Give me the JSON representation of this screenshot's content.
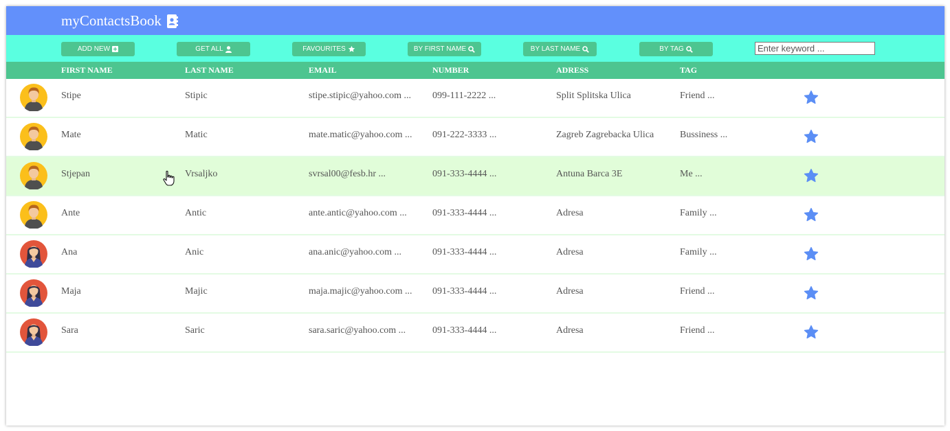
{
  "app": {
    "title": "myContactsBook",
    "title_icon": "address-book-icon"
  },
  "toolbar": {
    "buttons": [
      {
        "label": "ADD NEW",
        "icon": "plus-square-icon"
      },
      {
        "label": "GET ALL",
        "icon": "user-icon"
      },
      {
        "label": "FAVOURITES",
        "icon": "star-icon"
      },
      {
        "label": "BY FIRST NAME",
        "icon": "search-icon"
      },
      {
        "label": "BY LAST NAME",
        "icon": "search-icon"
      },
      {
        "label": "BY TAG",
        "icon": "search-icon"
      }
    ],
    "search": {
      "placeholder": "Enter keyword ...",
      "value": ""
    }
  },
  "table": {
    "headers": [
      "FIRST NAME",
      "LAST NAME",
      "EMAIL",
      "NUMBER",
      "ADRESS",
      "TAG"
    ],
    "rows": [
      {
        "first": "Stipe",
        "last": "Stipic",
        "email": "stipe.stipic@yahoo.com ...",
        "number": "099-111-2222 ...",
        "address": "Split Splitska Ulica",
        "tag": "Friend ...",
        "avatar": "male-avatar-icon"
      },
      {
        "first": "Mate",
        "last": "Matic",
        "email": "mate.matic@yahoo.com ...",
        "number": "091-222-3333 ...",
        "address": "Zagreb Zagrebacka Ulica",
        "tag": "Bussiness ...",
        "avatar": "male-avatar-icon"
      },
      {
        "first": "Stjepan",
        "last": "Vrsaljko",
        "email": "svrsal00@fesb.hr ...",
        "number": "091-333-4444 ...",
        "address": "Antuna Barca 3E",
        "tag": "Me ...",
        "avatar": "male-avatar-icon"
      },
      {
        "first": "Ante",
        "last": "Antic",
        "email": "ante.antic@yahoo.com ...",
        "number": "091-333-4444 ...",
        "address": "Adresa",
        "tag": "Family ...",
        "avatar": "male-avatar-icon"
      },
      {
        "first": "Ana",
        "last": "Anic",
        "email": "ana.anic@yahoo.com ...",
        "number": "091-333-4444 ...",
        "address": "Adresa",
        "tag": "Family ...",
        "avatar": "female-avatar-icon"
      },
      {
        "first": "Maja",
        "last": "Majic",
        "email": "maja.majic@yahoo.com ...",
        "number": "091-333-4444 ...",
        "address": "Adresa",
        "tag": "Friend ...",
        "avatar": "female-avatar-icon"
      },
      {
        "first": "Sara",
        "last": "Saric",
        "email": "sara.saric@yahoo.com ...",
        "number": "091-333-4444 ...",
        "address": "Adresa",
        "tag": "Friend ...",
        "avatar": "female-avatar-icon"
      }
    ]
  },
  "colors": {
    "topbar": "#6290fb",
    "toolbar": "#5affe0",
    "button": "#4dc590",
    "header": "#4dc590",
    "row_hover": "#e1fdd9",
    "star": "#5b8ef5"
  }
}
